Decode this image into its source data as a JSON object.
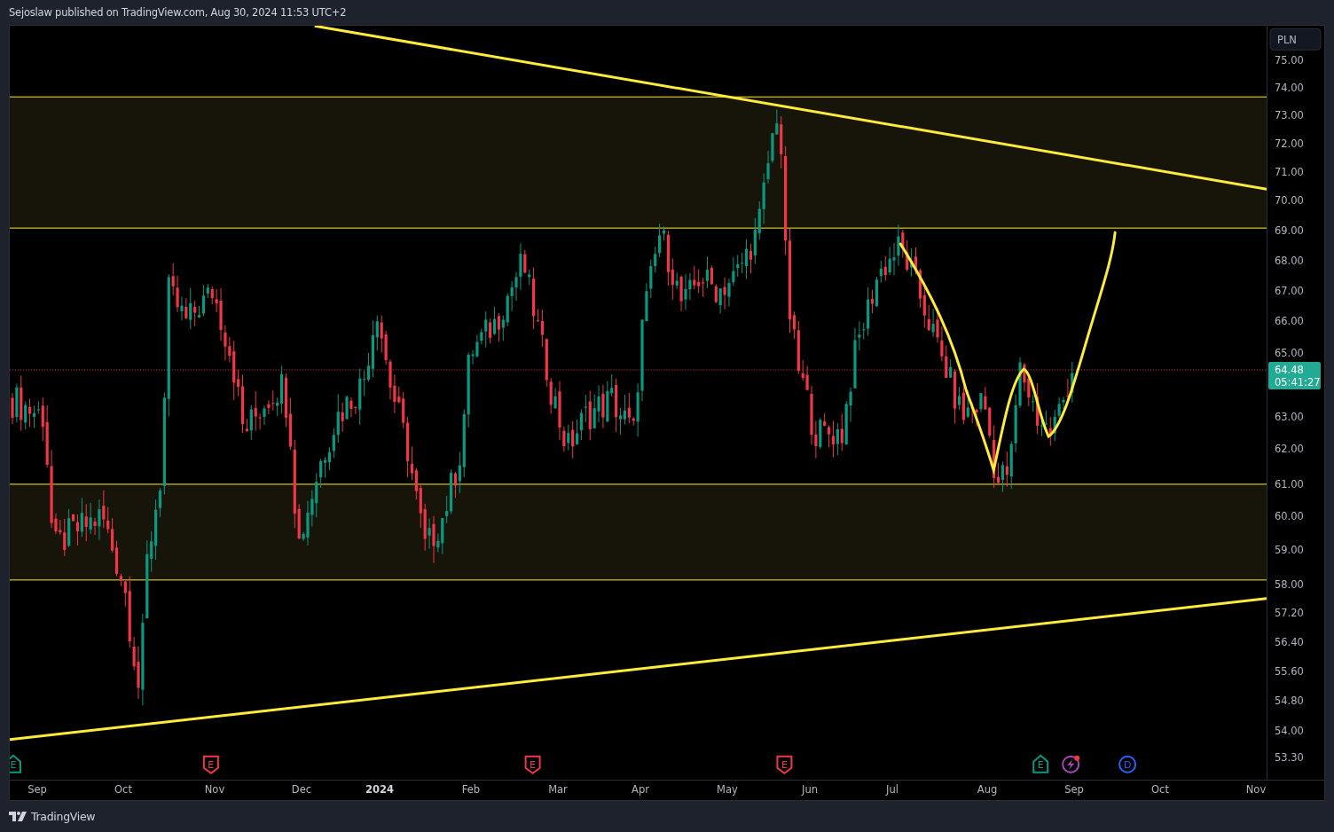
{
  "header": {
    "text": "Sejoslaw published on TradingView.com, Aug 30, 2024 11:53 UTC+2"
  },
  "price_axis": {
    "currency": "PLN",
    "ticks": [
      "75.00",
      "74.00",
      "73.00",
      "72.00",
      "71.00",
      "70.00",
      "69.00",
      "68.00",
      "67.00",
      "66.00",
      "65.00",
      "63.00",
      "62.00",
      "61.00",
      "60.00",
      "59.00",
      "58.00",
      "57.20",
      "56.40",
      "55.60",
      "54.80",
      "54.00",
      "53.30"
    ],
    "last_price": "64.48",
    "countdown": "05:41:27"
  },
  "time_axis": [
    {
      "label": "Sep",
      "bold": false
    },
    {
      "label": "Oct",
      "bold": false
    },
    {
      "label": "Nov",
      "bold": false
    },
    {
      "label": "Dec",
      "bold": false
    },
    {
      "label": "2024",
      "bold": true
    },
    {
      "label": "Feb",
      "bold": false
    },
    {
      "label": "Mar",
      "bold": false
    },
    {
      "label": "Apr",
      "bold": false
    },
    {
      "label": "May",
      "bold": false
    },
    {
      "label": "Jun",
      "bold": false
    },
    {
      "label": "Jul",
      "bold": false
    },
    {
      "label": "Aug",
      "bold": false
    },
    {
      "label": "Sep",
      "bold": false
    },
    {
      "label": "Oct",
      "bold": false
    },
    {
      "label": "Nov",
      "bold": false
    }
  ],
  "events": [
    {
      "kind": "earnings_up",
      "label": "E",
      "color": "#089981"
    },
    {
      "kind": "earnings_down",
      "label": "E",
      "color": "#f23645"
    },
    {
      "kind": "earnings_down",
      "label": "E",
      "color": "#f23645"
    },
    {
      "kind": "earnings_down",
      "label": "E",
      "color": "#f23645"
    },
    {
      "kind": "earnings_up",
      "label": "E",
      "color": "#089981"
    },
    {
      "kind": "news",
      "color": "#ab47bc"
    },
    {
      "kind": "dividend",
      "label": "D",
      "color": "#2962ff"
    }
  ],
  "footer": {
    "brand": "TradingView"
  }
}
